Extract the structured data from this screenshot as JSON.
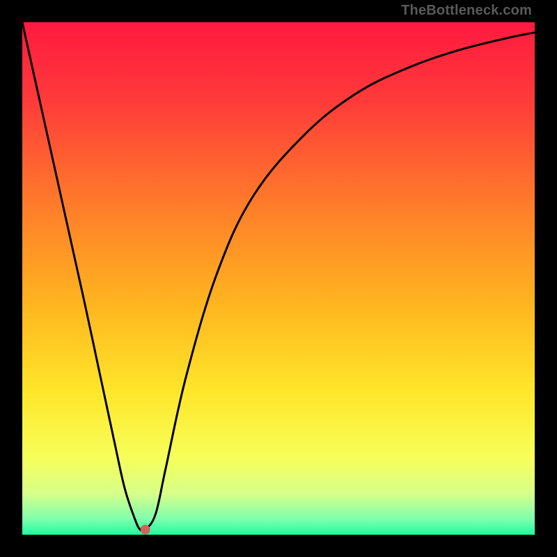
{
  "watermark": "TheBottleneck.com",
  "chart_data": {
    "type": "line",
    "title": "",
    "xlabel": "",
    "ylabel": "",
    "xlim": [
      0,
      100
    ],
    "ylim": [
      0,
      100
    ],
    "grid": false,
    "legend": false,
    "gradient_stops": [
      {
        "pos": 0.0,
        "color": "#ff1a3f"
      },
      {
        "pos": 0.15,
        "color": "#ff3a3a"
      },
      {
        "pos": 0.35,
        "color": "#ff7a2a"
      },
      {
        "pos": 0.55,
        "color": "#ffb51f"
      },
      {
        "pos": 0.72,
        "color": "#ffe62a"
      },
      {
        "pos": 0.85,
        "color": "#f6ff5a"
      },
      {
        "pos": 0.92,
        "color": "#d7ff8a"
      },
      {
        "pos": 0.97,
        "color": "#7dffad"
      },
      {
        "pos": 1.0,
        "color": "#1dff9e"
      }
    ],
    "series": [
      {
        "name": "curve",
        "x": [
          0,
          4,
          8,
          12,
          15,
          18,
          20,
          22,
          23,
          24,
          26,
          28,
          32,
          38,
          45,
          55,
          65,
          75,
          85,
          95,
          100
        ],
        "y": [
          100,
          82,
          64,
          46,
          32,
          18,
          9,
          3,
          1,
          1,
          4,
          13,
          31,
          51,
          66,
          78,
          86,
          91,
          94.5,
          97,
          98
        ]
      }
    ],
    "marker": {
      "x": 24,
      "y": 1,
      "color": "#c9675b",
      "radius_px": 7
    }
  }
}
